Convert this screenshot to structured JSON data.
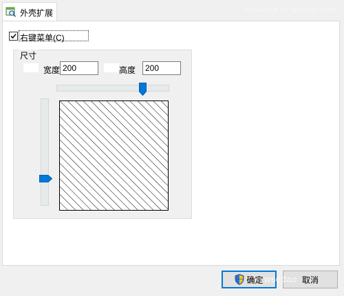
{
  "watermark": {
    "top_text": "Powered by wsedao.com",
    "bottom_text": "wsedao"
  },
  "tab": {
    "label": "外壳扩展",
    "icon": "shell-extension-icon"
  },
  "context_menu_option": {
    "label": "右键菜单(C)",
    "checked": true
  },
  "size_group": {
    "title": "尺寸",
    "width_label": "宽度",
    "width_value": "200",
    "height_label": "高度",
    "height_value": "200",
    "horizontal_slider_value": 0.8,
    "vertical_slider_value": 0.8
  },
  "buttons": {
    "ok_label": "确定",
    "cancel_label": "取消"
  },
  "colors": {
    "accent": "#0078d7",
    "default_button_border": "#0078d7"
  }
}
